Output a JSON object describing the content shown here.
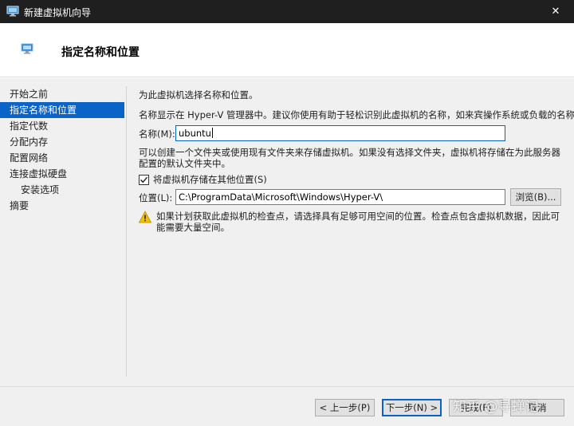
{
  "window": {
    "title": "新建虚拟机向导",
    "icon": "hyper-v-monitor-icon",
    "close_glyph": "✕"
  },
  "header": {
    "title": "指定名称和位置",
    "icon": "monitor-icon"
  },
  "nav": {
    "items": [
      {
        "label": "开始之前",
        "active": false
      },
      {
        "label": "指定名称和位置",
        "active": true
      },
      {
        "label": "指定代数",
        "active": false
      },
      {
        "label": "分配内存",
        "active": false
      },
      {
        "label": "配置网络",
        "active": false
      },
      {
        "label": "连接虚拟硬盘",
        "active": false
      },
      {
        "label": "安装选项",
        "active": false,
        "sub": true
      },
      {
        "label": "摘要",
        "active": false
      }
    ]
  },
  "content": {
    "heading": "为此虚拟机选择名称和位置。",
    "description": "名称显示在 Hyper-V 管理器中。建议你使用有助于轻松识别此虚拟机的名称，如来宾操作系统或负载的名称。",
    "name_label": "名称(M):",
    "name_value": "ubuntu",
    "folder_info": "可以创建一个文件夹或使用现有文件夹来存储虚拟机。如果没有选择文件夹，虚拟机将存储在为此服务器配置的默认文件夹中。",
    "store_elsewhere_label": "将虚拟机存储在其他位置(S)",
    "store_elsewhere_checked": true,
    "location_label": "位置(L):",
    "location_value": "C:\\ProgramData\\Microsoft\\Windows\\Hyper-V\\",
    "browse_label": "浏览(B)...",
    "warning_text": "如果计划获取此虚拟机的检查点，请选择具有足够可用空间的位置。检查点包含虚拟机数据，因此可能需要大量空间。"
  },
  "footer": {
    "prev_label": "< 上一步(P)",
    "next_label": "下一步(N) >",
    "finish_label": "完成(F)",
    "cancel_label": "取消"
  },
  "watermark": "知乎 @寻蝉记",
  "colors": {
    "accent": "#0a64c8",
    "titlebar": "#1f1f1f",
    "panel": "#f0f0f0",
    "warning": "#f2c200"
  }
}
